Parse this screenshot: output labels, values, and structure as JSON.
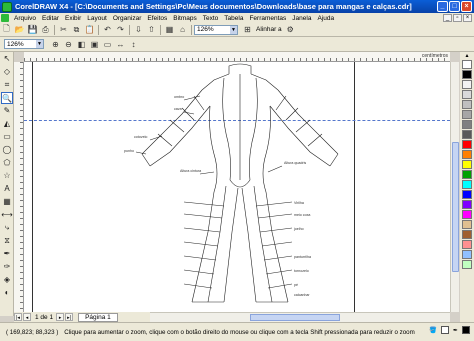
{
  "window": {
    "title": "CorelDRAW X4 - [C:\\Documents and Settings\\Pc\\Meus documentos\\Downloads\\base para mangas e calças.cdr]",
    "controls": [
      "_",
      "□",
      "×"
    ]
  },
  "menu": {
    "items": [
      "Arquivo",
      "Editar",
      "Exibir",
      "Layout",
      "Organizar",
      "Efeitos",
      "Bitmaps",
      "Texto",
      "Tabela",
      "Ferramentas",
      "Janela",
      "Ajuda"
    ]
  },
  "toolbar": {
    "zoom_value": "126%",
    "zoom_value_2": "126%",
    "align_label": "Alinhar a",
    "zoom_value_3": "126%"
  },
  "rulers": {
    "unit": "centímetros",
    "unit_left": "centímetros"
  },
  "drawing": {
    "labels": {
      "ombro": "ombro",
      "cava": "cava",
      "cotovelo": "cotovelo",
      "punho": "punho",
      "altura_cintura": "Altura cintura",
      "altura_quadris": "Altura quadris",
      "virilha": "Virilha",
      "meio_coxa": "meio coxa",
      "joelho": "joelho",
      "panturrilha": "panturrilha",
      "tornozelo": "tornozelo",
      "pe": "pé",
      "calcanhar": "calcanhar"
    }
  },
  "page_nav": {
    "page_count": "1 de 1",
    "tab_label": "Página 1"
  },
  "status": {
    "coordinates": "( 169,823; 88,323 )",
    "hint": "Clique para aumentar o zoom, clique com o botão direito do mouse ou clique com a tecla Shift pressionada para reduzir o zoom"
  },
  "palette": {
    "colors": [
      "#ffffff",
      "#000000",
      "#f2f2f2",
      "#d9d9d9",
      "#bfbfbf",
      "#a6a6a6",
      "#808080",
      "#595959",
      "#ff0000",
      "#ff8000",
      "#ffff00",
      "#00a000",
      "#00ffff",
      "#0000ff",
      "#8000ff",
      "#ff00ff",
      "#e0c090",
      "#a06030",
      "#ff9090",
      "#90c0ff",
      "#c0ffc0"
    ]
  }
}
